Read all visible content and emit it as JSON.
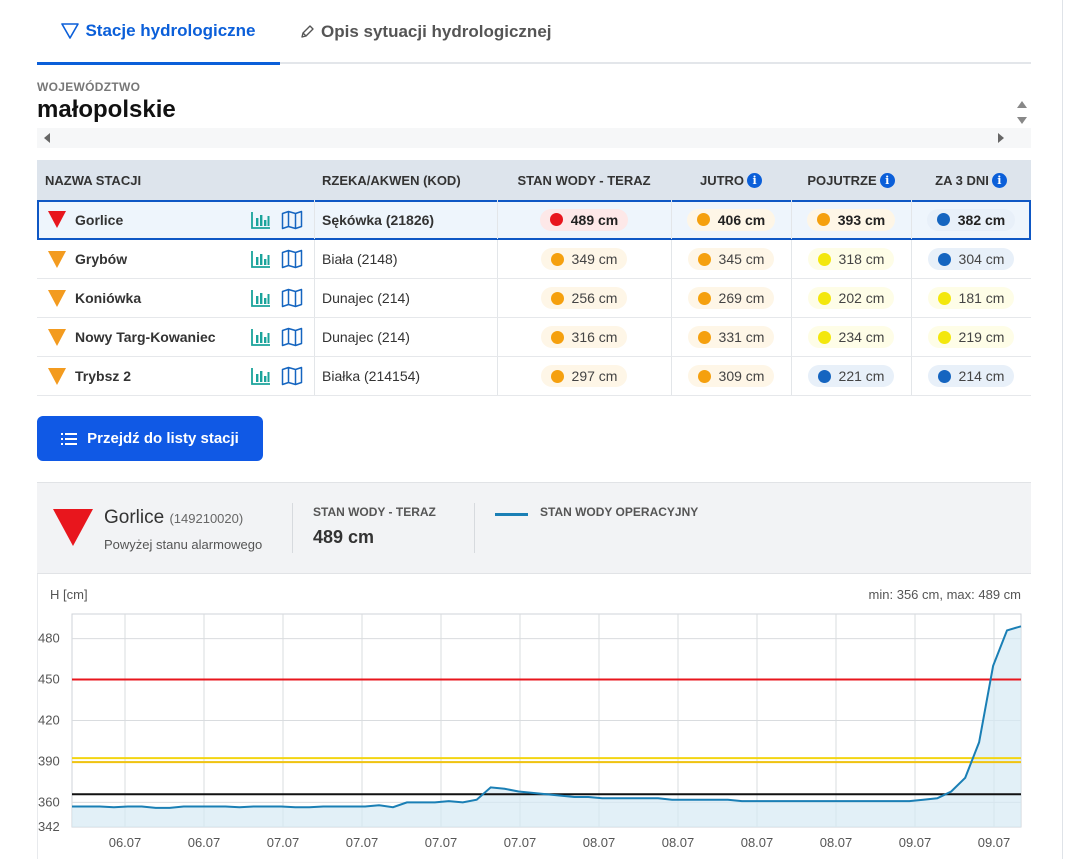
{
  "tabs": [
    {
      "label": "Stacje hydrologiczne",
      "icon": "filter-icon",
      "active": true
    },
    {
      "label": "Opis sytuacji hydrologicznej",
      "icon": "pen-icon",
      "active": false
    }
  ],
  "voivodeship": {
    "label": "WOJEWÓDZTWO",
    "value": "małopolskie"
  },
  "table": {
    "headers": {
      "name": "NAZWA STACJI",
      "river": "RZEKA/AKWEN (KOD)",
      "now": "STAN WODY - TERAZ",
      "tomorrow": "JUTRO",
      "dayafter": "POJUTRZE",
      "in3days": "ZA 3 DNI"
    },
    "rows": [
      {
        "name": "Gorlice",
        "river": "Sękówka (21826)",
        "alert": "red",
        "selected": true,
        "now": {
          "v": "489 cm",
          "c": "#e8161d"
        },
        "tomorrow": {
          "v": "406 cm",
          "c": "#f5a00e"
        },
        "dayafter": {
          "v": "393 cm",
          "c": "#f5a00e"
        },
        "in3days": {
          "v": "382 cm",
          "c": "#1565c0"
        }
      },
      {
        "name": "Grybów",
        "river": "Biała (2148)",
        "alert": "orange",
        "selected": false,
        "now": {
          "v": "349 cm",
          "c": "#f5a00e"
        },
        "tomorrow": {
          "v": "345 cm",
          "c": "#f5a00e"
        },
        "dayafter": {
          "v": "318 cm",
          "c": "#f3e70c"
        },
        "in3days": {
          "v": "304 cm",
          "c": "#1565c0"
        }
      },
      {
        "name": "Koniówka",
        "river": "Dunajec (214)",
        "alert": "orange",
        "selected": false,
        "now": {
          "v": "256 cm",
          "c": "#f5a00e"
        },
        "tomorrow": {
          "v": "269 cm",
          "c": "#f5a00e"
        },
        "dayafter": {
          "v": "202 cm",
          "c": "#f3e70c"
        },
        "in3days": {
          "v": "181 cm",
          "c": "#f3e70c"
        }
      },
      {
        "name": "Nowy Targ-Kowaniec",
        "river": "Dunajec (214)",
        "alert": "orange",
        "selected": false,
        "now": {
          "v": "316 cm",
          "c": "#f5a00e"
        },
        "tomorrow": {
          "v": "331 cm",
          "c": "#f5a00e"
        },
        "dayafter": {
          "v": "234 cm",
          "c": "#f3e70c"
        },
        "in3days": {
          "v": "219 cm",
          "c": "#f3e70c"
        }
      },
      {
        "name": "Trybsz 2",
        "river": "Białka (214154)",
        "alert": "orange",
        "selected": false,
        "now": {
          "v": "297 cm",
          "c": "#f5a00e"
        },
        "tomorrow": {
          "v": "309 cm",
          "c": "#f5a00e"
        },
        "dayafter": {
          "v": "221 cm",
          "c": "#1565c0"
        },
        "in3days": {
          "v": "214 cm",
          "c": "#1565c0"
        }
      }
    ]
  },
  "button": {
    "label": "Przejdź do listy stacji",
    "icon": "list-icon"
  },
  "station": {
    "name": "Gorlice",
    "code": "(149210020)",
    "status": "Powyżej stanu alarmowego",
    "current_label": "STAN WODY - TERAZ",
    "current_value": "489 cm",
    "legend": "STAN WODY OPERACYJNY"
  },
  "chart_data": {
    "type": "line",
    "ylabel": "H [cm]",
    "range_text": "min: 356 cm, max: 489 cm",
    "ylim": [
      342,
      498
    ],
    "yticks": [
      342,
      360,
      390,
      420,
      450,
      480
    ],
    "xticks": [
      "06.07",
      "06.07",
      "07.07",
      "07.07",
      "07.07",
      "07.07",
      "08.07",
      "08.07",
      "08.07",
      "08.07",
      "09.07",
      "09.07"
    ],
    "thresholds": [
      {
        "name": "alarm",
        "value": 450,
        "color": "#e8161d"
      },
      {
        "name": "warning",
        "value": 391,
        "color": "#f3d511"
      },
      {
        "name": "low",
        "value": 366,
        "color": "#111111"
      }
    ],
    "series": [
      {
        "color": "#1a7fb5",
        "values": [
          357,
          357,
          357,
          356.5,
          357,
          357,
          356,
          356,
          357,
          357,
          357,
          357,
          356.5,
          357,
          357,
          357,
          356.5,
          356.5,
          357,
          357,
          357,
          357,
          358,
          356.5,
          360,
          360,
          360,
          361,
          360,
          362,
          371,
          370,
          368,
          367,
          366,
          365,
          364,
          364,
          363,
          363,
          363,
          363,
          363,
          362,
          362,
          362,
          362,
          362,
          361,
          361,
          361,
          361,
          361,
          361,
          361,
          361,
          361,
          361,
          361,
          361,
          361,
          362,
          363,
          368,
          378,
          404,
          460,
          486,
          489
        ]
      }
    ]
  }
}
